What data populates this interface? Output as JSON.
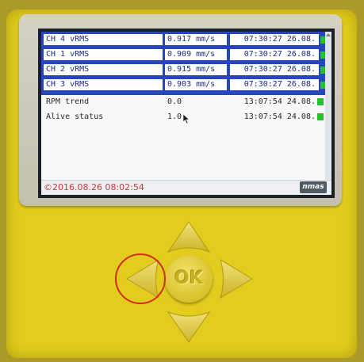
{
  "channels": [
    {
      "name": "CH 4 vRMS",
      "value": "0.917 mm/s",
      "time": "07:30:27 26.08.",
      "selected": true
    },
    {
      "name": "CH 1 vRMS",
      "value": "0.909 mm/s",
      "time": "07:30:27 26.08.",
      "selected": true
    },
    {
      "name": "CH 2 vRMS",
      "value": "0.915 mm/s",
      "time": "07:30:27 26.08.",
      "selected": true
    },
    {
      "name": "CH 3 vRMS",
      "value": "0.903 mm/s",
      "time": "07:30:27 26.08.",
      "selected": true
    },
    {
      "name": "RPM trend",
      "value": "0.0",
      "time": "13:07:54 24.08.",
      "selected": false
    },
    {
      "name": "Alive status",
      "value": "1.0",
      "time": "13:07:54 24.08.",
      "selected": false
    }
  ],
  "status_bar": {
    "datetime": "©2016.08.26 08:02:54",
    "logo": "nmas"
  },
  "keypad": {
    "ok_label": "OK",
    "highlighted_key": "left"
  },
  "colors": {
    "housing": "#e2cd1c",
    "selection": "#2747b8",
    "indicator": "#25c22e",
    "annotation": "#d62a1e"
  }
}
